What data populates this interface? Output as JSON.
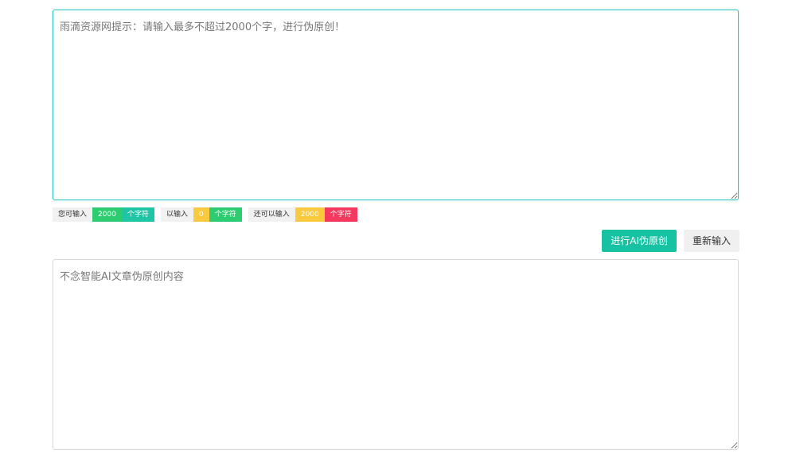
{
  "input": {
    "placeholder": "雨滴资源网提示：请输入最多不超过2000个字，进行伪原创！"
  },
  "counters": [
    {
      "label": "您可输入",
      "value": "2000",
      "unit": "个字符",
      "value_color": "#2ed573",
      "unit_color": "#2ed573"
    },
    {
      "label": "以输入",
      "value": "0",
      "unit": "个字符",
      "value_color": "#f9ca24",
      "unit_color": "#2ed573"
    },
    {
      "label": "还可以输入",
      "value": "2000",
      "unit": "个字符",
      "value_color": "#f9ca24",
      "unit_color": "#ff4757"
    }
  ],
  "actions": {
    "rewrite_label": "进行AI伪原创",
    "reset_label": "重新输入"
  },
  "output": {
    "placeholder": "不念智能AI文章伪原创内容"
  },
  "colors": {
    "accent": "#17c2a3",
    "input_border": "#2fc4bf"
  }
}
